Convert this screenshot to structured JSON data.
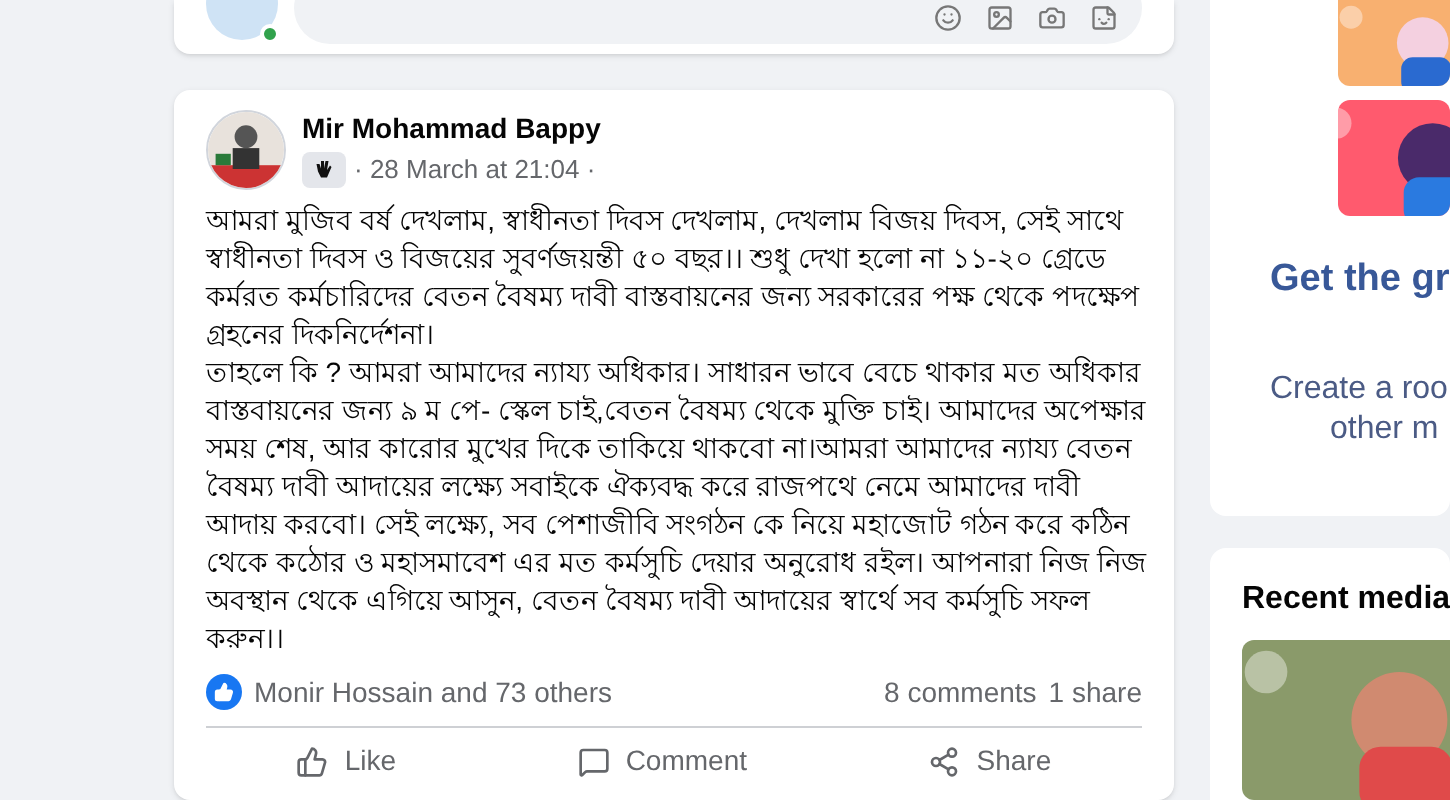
{
  "composer": {
    "online": true
  },
  "post": {
    "author": "Mir Mohammad Bappy",
    "time": "· 28 March at 21:04 ·",
    "paragraphs": [
      "আমরা মুজিব বর্ষ দেখলাম, স্বাধীনতা দিবস দেখলাম,  দেখলাম বিজয় দিবস, সেই সাথে স্বাধীনতা দিবস  ও বিজয়ের সুবর্ণজয়ন্তী ৫০ বছর।। শুধু দেখা হলো না ১১-২০ গ্রেডে কর্মরত কর্মচারিদের বেতন বৈষম্য দাবী বাস্তবায়নের জন্য সরকারের পক্ষ থেকে পদক্ষেপ গ্রহনের দিকনির্দেশনা।",
      "তাহলে কি ?  আমরা আমাদের ন্যায্য অধিকার। সাধারন ভাবে বেচে থাকার মত অধিকার বাস্তবায়নের জন্য  ৯ ম পে- স্কেল  চাই,বেতন বৈষম্য থেকে মুক্তি চাই।  আমাদের অপেক্ষার সময় শেষ, আর কারোর মুখের দিকে তাকিয়ে থাকবো না।আমরা আমাদের ন্যায্য বেতন বৈষম্য দাবী আদায়ের লক্ষ্যে সবাইকে ঐক্যবদ্ধ করে রাজপথে নেমে আমাদের দাবী আদায় করবো। সেই লক্ষ্যে, সব পেশাজীবি সংগঠন কে নিয়ে মহাজোট গঠন করে কঠিন থেকে কঠোর ও মহাসমাবেশ  এর মত কর্মসুচি দেয়ার অনুরোধ রইল। আপনারা নিজ নিজ অবস্থান থেকে এগিয়ে আসুন, বেতন বৈষম্য দাবী আদায়ের স্বার্থে সব কর্মসুচি সফল করুন।।"
    ],
    "reactions": "Monir Hossain and 73 others",
    "comments": "8 comments",
    "shares": "1 share",
    "actions": [
      "Like",
      "Comment",
      "Share"
    ]
  },
  "rooms_card": {
    "title": "Get the gr",
    "text_lines": [
      "Create a roo",
      "other m"
    ]
  },
  "recent_media": {
    "title": "Recent media"
  }
}
